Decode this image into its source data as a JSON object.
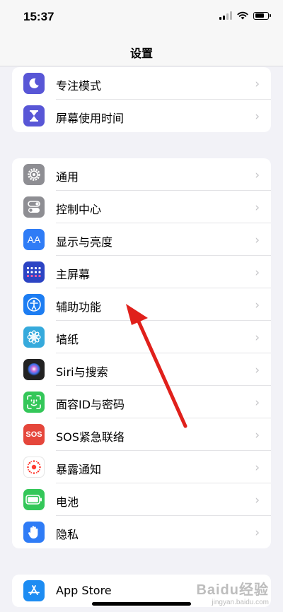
{
  "status_bar": {
    "time": "15:37",
    "battery_level": 0.8
  },
  "nav": {
    "title": "设置"
  },
  "groups": [
    {
      "items": [
        {
          "label": "专注模式",
          "icon": "moon-icon",
          "color": "#5856d6"
        },
        {
          "label": "屏幕使用时间",
          "icon": "hourglass-icon",
          "color": "#5856d6"
        }
      ]
    },
    {
      "items": [
        {
          "label": "通用",
          "icon": "gear-icon",
          "color": "#8e8e93"
        },
        {
          "label": "控制中心",
          "icon": "toggles-icon",
          "color": "#8e8e93"
        },
        {
          "label": "显示与亮度",
          "icon": "text-size-icon",
          "color": "#2f7cf6"
        },
        {
          "label": "主屏幕",
          "icon": "home-grid-icon",
          "color": "#2c44c4"
        },
        {
          "label": "辅助功能",
          "icon": "accessibility-icon",
          "color": "#1d7df2"
        },
        {
          "label": "墙纸",
          "icon": "flower-icon",
          "color": "#36aadc"
        },
        {
          "label": "Siri与搜索",
          "icon": "siri-icon",
          "color": "#222222"
        },
        {
          "label": "面容ID与密码",
          "icon": "face-id-icon",
          "color": "#34c759"
        },
        {
          "label": "SOS紧急联络",
          "icon": "sos-icon",
          "color": "#e5463b"
        },
        {
          "label": "暴露通知",
          "icon": "exposure-icon",
          "color": "#ffffff"
        },
        {
          "label": "电池",
          "icon": "battery-icon",
          "color": "#34c759"
        },
        {
          "label": "隐私",
          "icon": "hand-icon",
          "color": "#2f7cf6"
        }
      ]
    },
    {
      "items": [
        {
          "label": "App Store",
          "icon": "app-store-icon",
          "color": "#1d8cf2"
        }
      ]
    }
  ],
  "icon_glyphs": {
    "sos": "SOS",
    "text_size": "AA"
  },
  "chevron": "›",
  "watermark": {
    "main": "Baidu经验",
    "sub": "jingyan.baidu.com"
  }
}
